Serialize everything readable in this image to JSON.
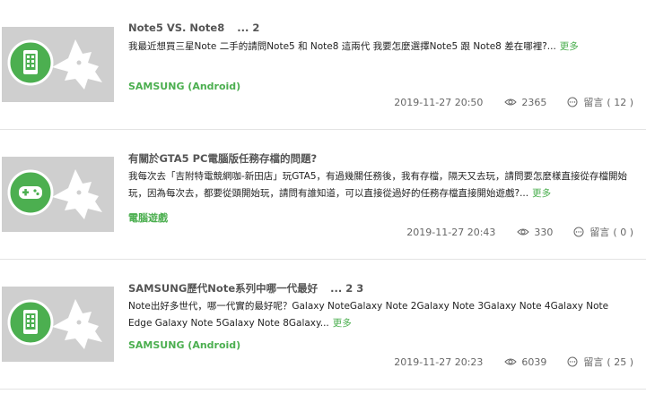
{
  "posts": [
    {
      "title": "Note5 VS. Note8",
      "ellipsis": "...",
      "pages": [
        "2"
      ],
      "excerpt": "我最近想買三星Note 二手的請問Note5 和 Note8 這兩代 我要怎麼選擇Note5 跟 Note8 差在哪裡?...",
      "more": "更多",
      "category": "SAMSUNG (Android)",
      "date": "2019-11-27 20:50",
      "views": "2365",
      "comments_label": "留言",
      "comments": "( 12 )",
      "icon": "phone-icon"
    },
    {
      "title": "有關於GTA5 PC電腦版任務存檔的問題?",
      "ellipsis": "",
      "pages": [],
      "excerpt": "我每次去「吉附特電競網咖-新田店」玩GTA5，有過幾關任務後，我有存檔，隔天又去玩，請問要怎麼樣直接從存檔開始玩，因為每次去，都要從頭開始玩，請問有誰知道，可以直接從過好的任務存檔直接開始遊戲?...",
      "more": "更多",
      "category": "電腦遊戲",
      "date": "2019-11-27 20:43",
      "views": "330",
      "comments_label": "留言",
      "comments": "( 0 )",
      "icon": "gamepad-icon"
    },
    {
      "title": "SAMSUNG歷代Note系列中哪一代最好",
      "ellipsis": "...",
      "pages": [
        "2",
        "3"
      ],
      "excerpt": "Note出好多世代，哪一代實的最好呢？Galaxy NoteGalaxy Note 2Galaxy Note 3Galaxy Note 4Galaxy Note Edge Galaxy Note 5Galaxy Note 8Galaxy...",
      "more": "更多",
      "category": "SAMSUNG (Android)",
      "date": "2019-11-27 20:23",
      "views": "6039",
      "comments_label": "留言",
      "comments": "( 25 )",
      "icon": "phone-icon"
    }
  ],
  "colors": {
    "accent": "#4caf50",
    "thumb_bg": "#cfcfcf",
    "divider": "#e3e3e3"
  }
}
